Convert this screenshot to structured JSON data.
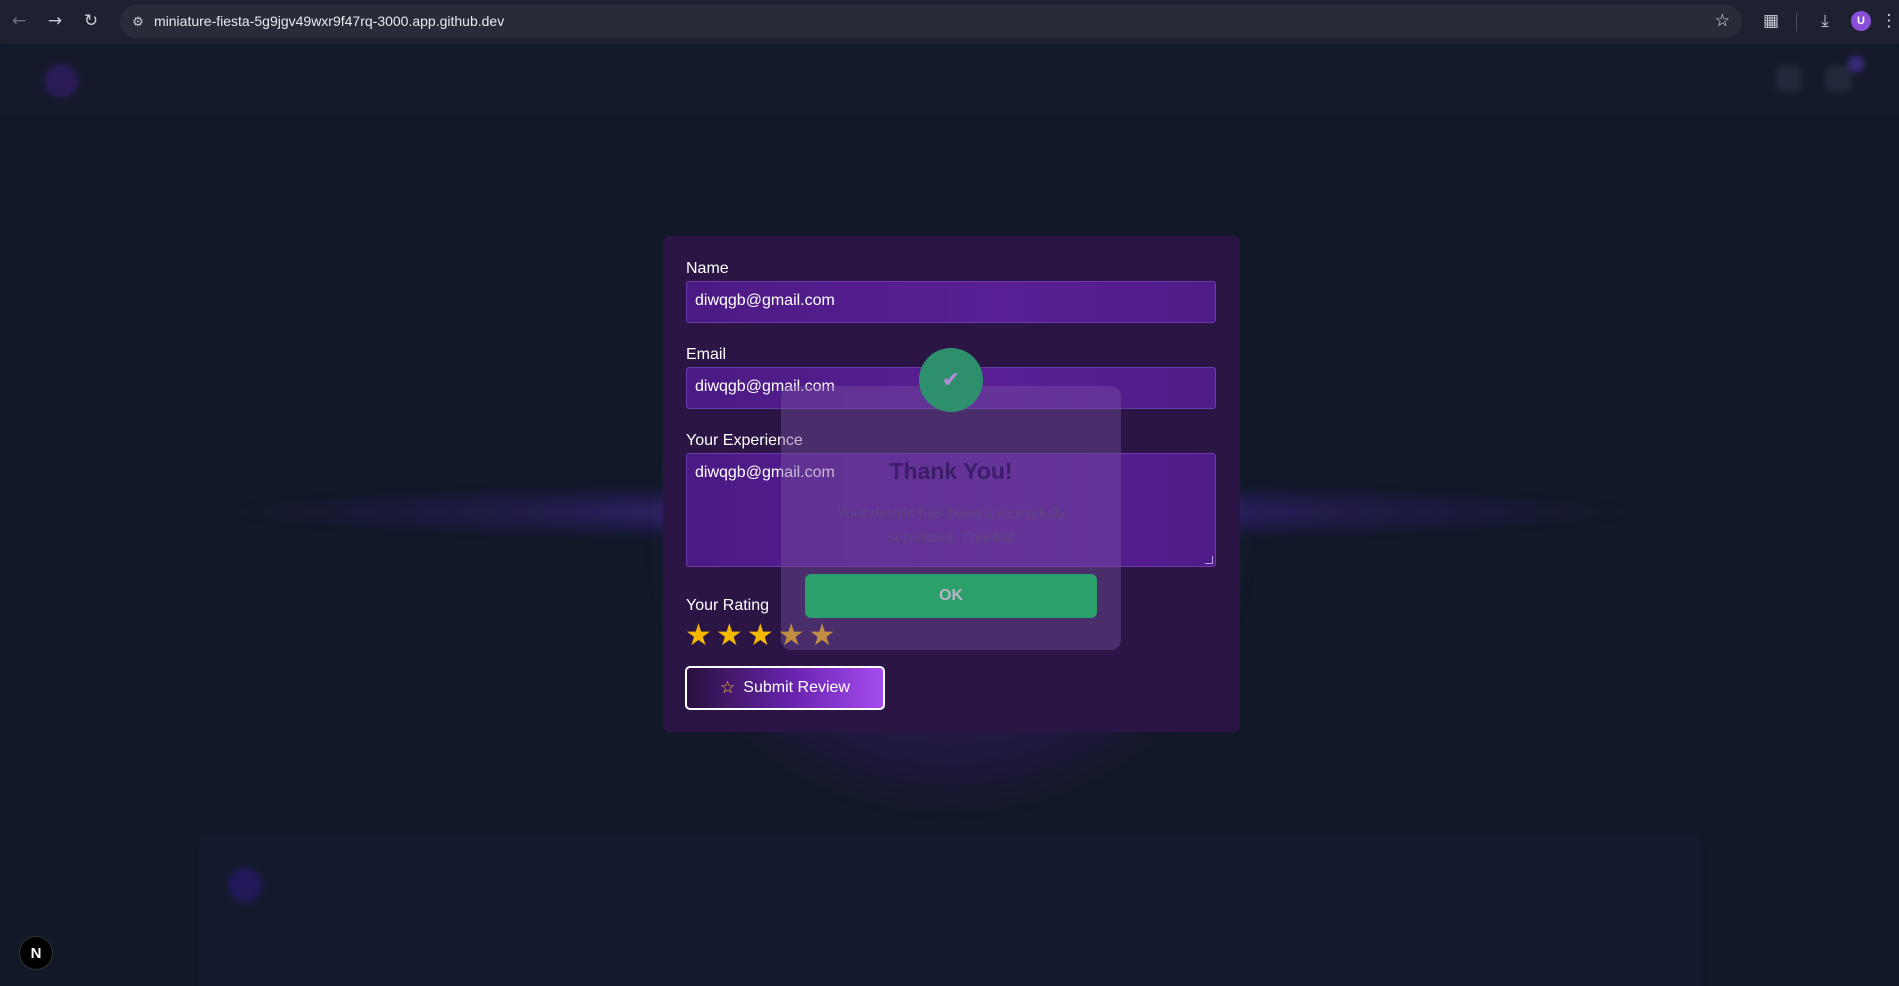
{
  "browser": {
    "url": "miniature-fiesta-5g9jgv49wxr9f47rq-3000.app.github.dev",
    "avatar_letter": "U",
    "icons": {
      "back": "arrow-left-icon",
      "forward": "arrow-right-icon",
      "reload": "reload-icon",
      "site_info": "tune-icon",
      "bookmark": "star-outline-icon",
      "extensions": "puzzle-icon",
      "downloads": "download-icon",
      "menu": "kebab-menu-icon"
    }
  },
  "form": {
    "name_label": "Name",
    "name_value": "diwqgb@gmail.com",
    "email_label": "Email",
    "email_value": "diwqgb@gmail.com",
    "experience_label": "Your Experience",
    "experience_value": "diwqgb@gmail.com",
    "rating_label": "Your Rating",
    "rating_value": 5,
    "rating_max": 5,
    "submit_label": "Submit Review"
  },
  "modal": {
    "title": "Thank You!",
    "message": "Your details has been successfully submitted. Thanks!",
    "ok_label": "OK"
  },
  "next_badge": "N",
  "colors": {
    "accent_purple": "#a64cf0",
    "success_green": "#2ca06a",
    "star_gold": "#f5b800",
    "background": "#111827"
  }
}
